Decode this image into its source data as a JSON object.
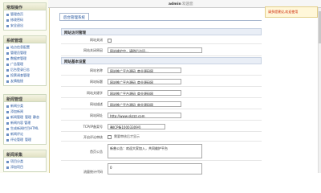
{
  "topbar": {
    "title_prefix": "admin",
    "title_suffix": "欢迎您"
  },
  "alert": {
    "text": "请多提建议,欢迎使用"
  },
  "sidebar": {
    "panels": [
      {
        "title": "常规操作",
        "items": [
          {
            "label": "管理首页"
          },
          {
            "label": "修改密码"
          },
          {
            "label": "安全退出"
          }
        ]
      },
      {
        "title": "系统管理",
        "items": [
          {
            "label": "站点信息配置"
          },
          {
            "label": "管理员管理"
          },
          {
            "label": "数据库管理"
          },
          {
            "label": "广告管理"
          },
          {
            "label": "后台登录日志"
          },
          {
            "label": "投票调查管理"
          },
          {
            "label": "友情链接"
          }
        ]
      },
      {
        "title": "新闻管理",
        "items": [
          {
            "label": "新闻分类"
          },
          {
            "label": "添加新闻"
          },
          {
            "label": "新闻管理",
            "extra1": "管理",
            "extra2": "静态"
          },
          {
            "label": "新闻内容 管理"
          },
          {
            "label": "生成新闻栏目HTML"
          },
          {
            "label": "新闻评论"
          },
          {
            "label": "评论管理",
            "extra1": "管理"
          }
        ]
      },
      {
        "title": "新闻采集",
        "items": [
          {
            "label": "项目分类"
          },
          {
            "label": "添加项目"
          }
        ]
      }
    ]
  },
  "content": {
    "tab_label": "后台管理系统",
    "section_close": "网站访问管理",
    "section_basic": "网站基本设置",
    "rows": {
      "close_label": "网站关闭",
      "close_msg_label": "网站关闭原因",
      "close_msg_value": "网站维护中，请稍后访问...",
      "name_label": "网站名称",
      "name_value": "网站推广平台源码_商业源码网",
      "title_label": "网站标题",
      "title_value": "网站推广平台源码_商业源码网",
      "keywords_label": "网站关键字",
      "keywords_value": "网站推广平台源码_商业源码网",
      "desc_label": "网站描述",
      "desc_value": "网站推广平台源码_商业源码网",
      "url_label": "网站网址",
      "url_value": "http://www.skzzz.com",
      "icp_label": "TCP/IP备案号",
      "icp_value": "豫ICP备10003309号",
      "comment_label": "开启评论审核",
      "comment_hint": "需要审核后才显示",
      "notice_label": "首页公告",
      "notice_value": "新普公告：欢迎大家加入，共同维护平台",
      "stats_label": "流量统计代码",
      "stats_value": "0"
    }
  }
}
